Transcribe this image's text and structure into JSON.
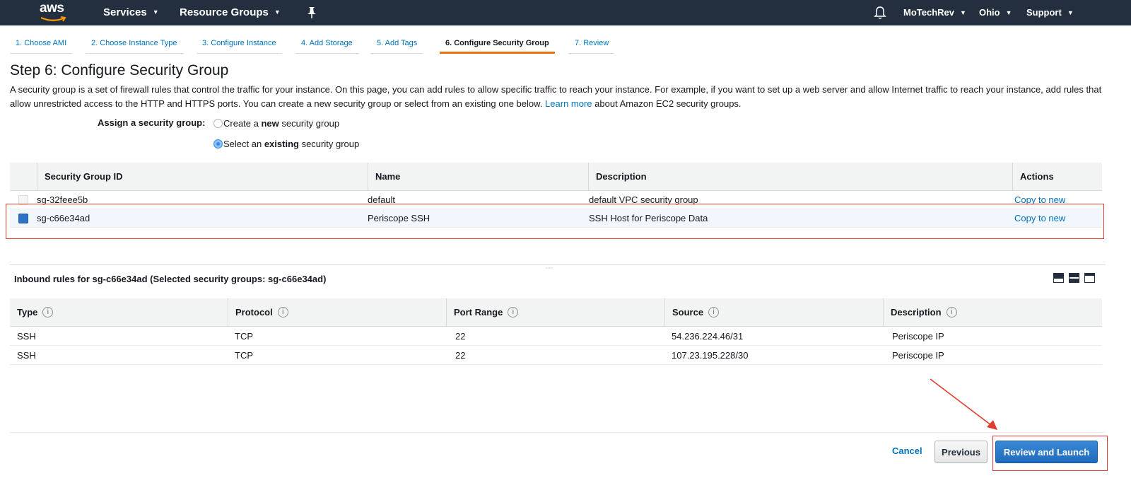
{
  "topnav": {
    "logo_text": "aws",
    "services_label": "Services",
    "resource_groups_label": "Resource Groups",
    "pin_icon": "pin-icon",
    "bell_icon": "bell-icon",
    "account_label": "MoTechRev",
    "region_label": "Ohio",
    "support_label": "Support",
    "caret_glyph": "▼",
    "colors": {
      "bar": "#232f3e",
      "text": "#ffffff"
    }
  },
  "wizard": {
    "tabs": [
      {
        "label": "1. Choose AMI"
      },
      {
        "label": "2. Choose Instance Type"
      },
      {
        "label": "3. Configure Instance"
      },
      {
        "label": "4. Add Storage"
      },
      {
        "label": "5. Add Tags"
      },
      {
        "label": "6. Configure Security Group",
        "active": true
      },
      {
        "label": "7. Review"
      }
    ],
    "active_color": "#ec7211"
  },
  "page": {
    "title": "Step 6: Configure Security Group",
    "intro_part1": "A security group is a set of firewall rules that control the traffic for your instance. On this page, you can add rules to allow specific traffic to reach your instance. For example, if you want to set up a web server and allow Internet traffic to reach your instance, add rules that allow unrestricted access to the HTTP and HTTPS ports. You can create a new security group or select from an existing one below.",
    "learn_more": "Learn more",
    "intro_part2": "about Amazon EC2 security groups."
  },
  "assign": {
    "label": "Assign a security group:",
    "option_create_pre": "Create a ",
    "option_create_bold": "new",
    "option_create_post": " security group",
    "option_existing_pre": "Select an ",
    "option_existing_bold": "existing",
    "option_existing_post": " security group",
    "selected": "existing"
  },
  "sg_table": {
    "headers": {
      "id": "Security Group ID",
      "name": "Name",
      "description": "Description",
      "actions": "Actions"
    },
    "rows": [
      {
        "id": "sg-32feee5b",
        "name": "default",
        "description": "default VPC security group",
        "action": "Copy to new",
        "checked": false
      },
      {
        "id": "sg-c66e34ad",
        "name": "Periscope SSH",
        "description": "SSH Host for Periscope Data",
        "action": "Copy to new",
        "checked": true
      }
    ]
  },
  "inbound": {
    "title": "Inbound rules for sg-c66e34ad (Selected security groups: sg-c66e34ad)",
    "grip": "▫▫▫",
    "headers": {
      "type": "Type",
      "protocol": "Protocol",
      "port_range": "Port Range",
      "source": "Source",
      "description": "Description"
    },
    "info_glyph": "i",
    "rows": [
      {
        "type": "SSH",
        "protocol": "TCP",
        "port_range": "22",
        "source": "54.236.224.46/31",
        "description": "Periscope IP"
      },
      {
        "type": "SSH",
        "protocol": "TCP",
        "port_range": "22",
        "source": "107.23.195.228/30",
        "description": "Periscope IP"
      }
    ]
  },
  "footer": {
    "cancel_label": "Cancel",
    "previous_label": "Previous",
    "launch_label": "Review and Launch"
  },
  "annotation_color": "#e33b2f"
}
